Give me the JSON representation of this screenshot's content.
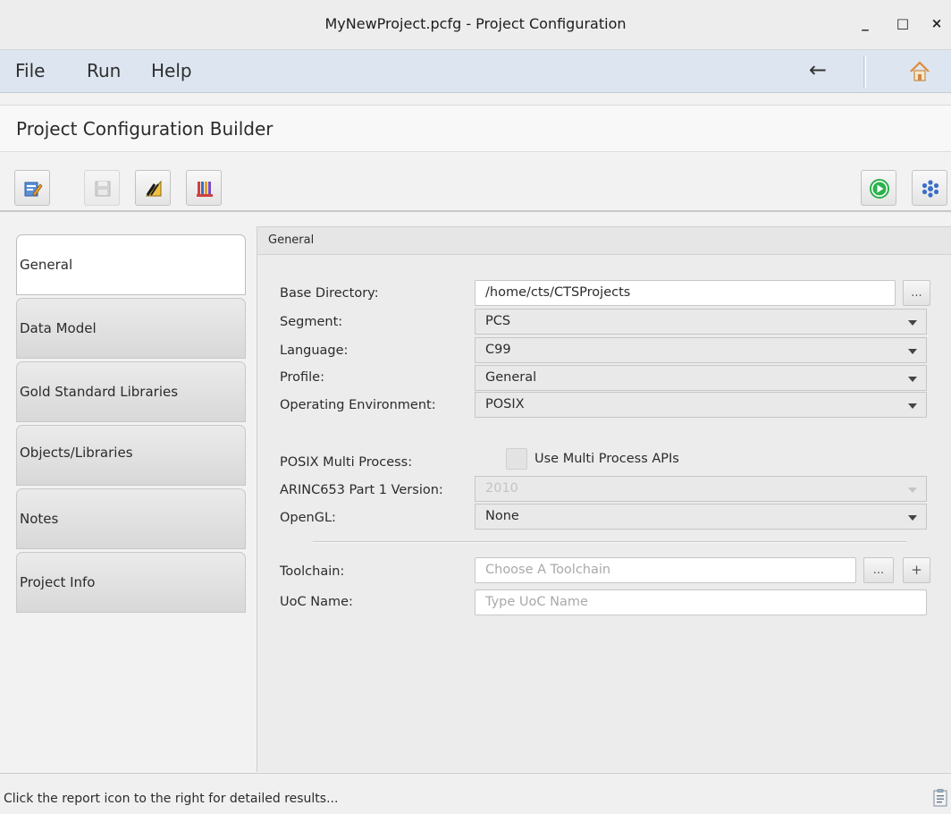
{
  "window": {
    "title": "MyNewProject.pcfg - Project Configuration",
    "minimize_glyph": "_",
    "maximize_glyph": "□",
    "close_glyph": "×"
  },
  "menu": {
    "items": [
      "File",
      "Run",
      "Help"
    ],
    "back_glyph": "←",
    "home_icon": "home-icon"
  },
  "heading": "Project Configuration Builder",
  "toolbar": {
    "left_buttons": [
      "edit-icon",
      "save-icon",
      "ruler-icon",
      "books-icon"
    ],
    "right_buttons": [
      "run-icon",
      "settings-icon"
    ],
    "save_disabled": true
  },
  "nav": {
    "tabs": [
      "General",
      "Data Model",
      "Gold Standard Libraries",
      "Objects/Libraries",
      "Notes",
      "Project Info"
    ],
    "active": "General"
  },
  "panel": {
    "header": "General",
    "base_directory": {
      "label": "Base Directory:",
      "value": "/home/cts/CTSProjects",
      "browse": "..."
    },
    "segment": {
      "label": "Segment:",
      "value": "PCS"
    },
    "language": {
      "label": "Language:",
      "value": "C99"
    },
    "profile": {
      "label": "Profile:",
      "value": "General"
    },
    "operating_environment": {
      "label": "Operating Environment:",
      "value": "POSIX"
    },
    "posix_multi_process": {
      "label": "POSIX Multi Process:",
      "checkbox_label": "Use Multi Process APIs",
      "checked": false
    },
    "arinc653": {
      "label": "ARINC653 Part 1 Version:",
      "value": "2010",
      "disabled": true
    },
    "opengl": {
      "label": "OpenGL:",
      "value": "None"
    },
    "toolchain": {
      "label": "Toolchain:",
      "placeholder": "Choose A Toolchain",
      "browse": "...",
      "add": "+"
    },
    "uoc_name": {
      "label": "UoC Name:",
      "placeholder": "Type UoC Name"
    }
  },
  "status": {
    "message": "Click the report icon to the right for detailed results..."
  },
  "colors": {
    "menubar": "#dde6f0",
    "run_green": "#2bb24c",
    "settings_blue": "#3a6ec7"
  }
}
